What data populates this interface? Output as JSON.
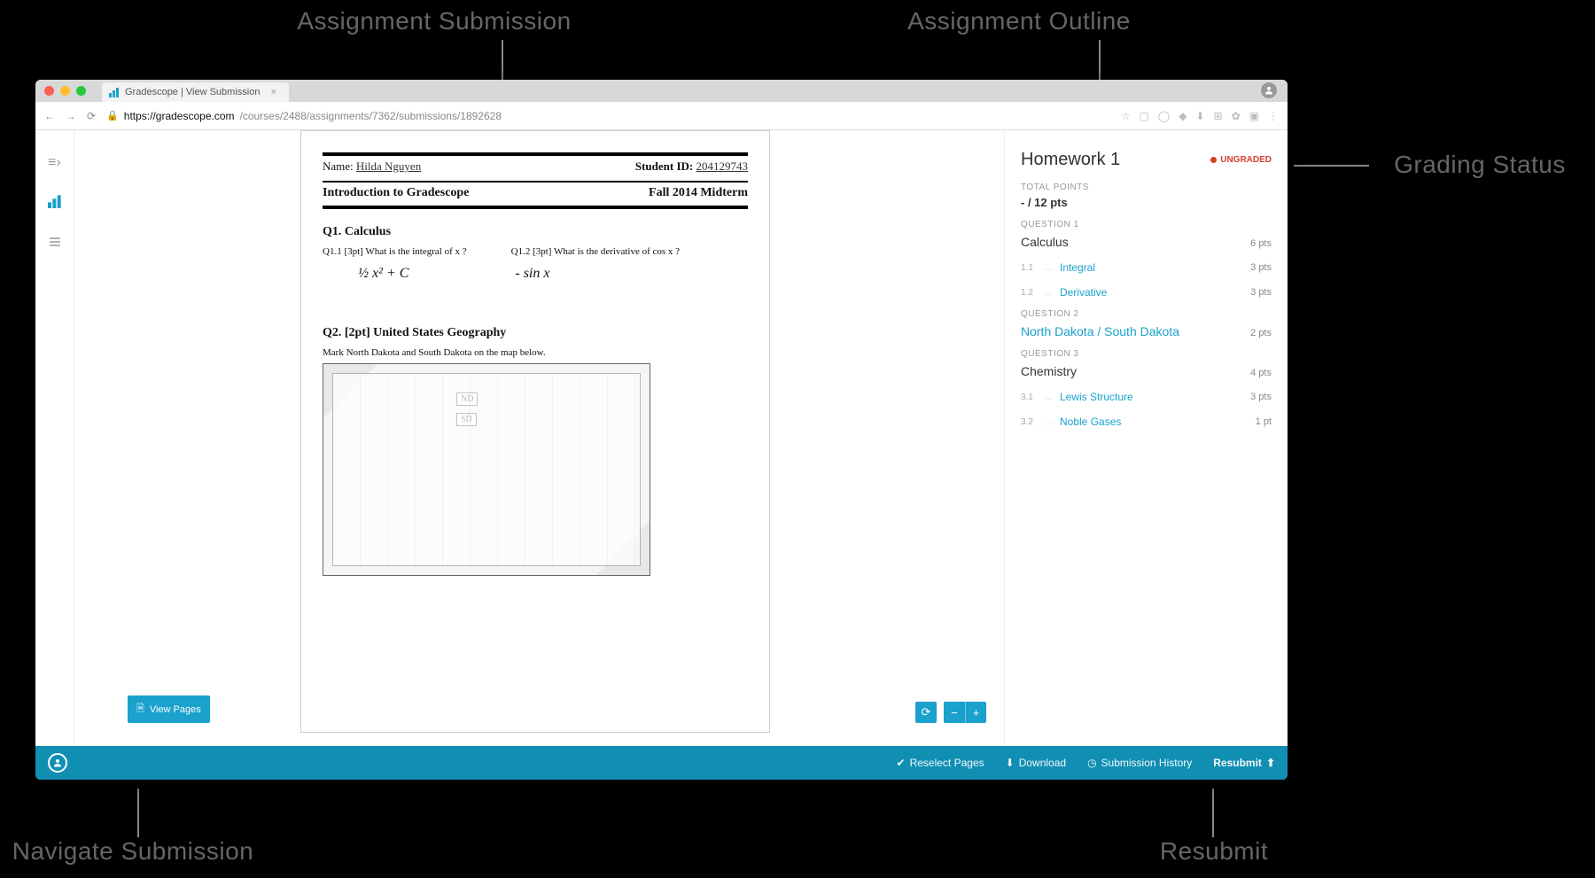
{
  "annotations": {
    "top_left": "Assignment Submission",
    "top_right": "Assignment Outline",
    "right": "Grading Status",
    "bottom_left": "Navigate Submission",
    "bottom_right": "Resubmit"
  },
  "browser": {
    "tab_title": "Gradescope | View Submission",
    "url_host": "https://gradescope.com",
    "url_path": "/courses/2488/assignments/7362/submissions/1892628"
  },
  "scan": {
    "name_label": "Name:",
    "name_value": "Hilda Nguyen",
    "sid_label": "Student ID:",
    "sid_value": "204129743",
    "course_title": "Introduction to Gradescope",
    "exam_title": "Fall 2014 Midterm",
    "q1_title": "Q1.  Calculus",
    "q11": "Q1.1  [3pt]  What is the integral of x ?",
    "q12": "Q1.2  [3pt]  What is the derivative of  cos x ?",
    "ans11": "½ x² + C",
    "ans12": "- sin x",
    "q2_title": "Q2.  [2pt] United States Geography",
    "q2_instr": "Mark North Dakota and South Dakota on the map below.",
    "map_nd": "ND",
    "map_sd": "SD"
  },
  "controls": {
    "view_pages": "View Pages"
  },
  "outline": {
    "title": "Homework 1",
    "status": "UNGRADED",
    "total_label": "TOTAL POINTS",
    "total_value": "- / 12 pts",
    "q1": {
      "label": "QUESTION 1",
      "name": "Calculus",
      "pts": "6 pts",
      "subs": [
        {
          "num": "1.1",
          "name": "Integral",
          "pts": "3 pts"
        },
        {
          "num": "1.2",
          "name": "Derivative",
          "pts": "3 pts"
        }
      ]
    },
    "q2": {
      "label": "QUESTION 2",
      "name": "North Dakota / South Dakota",
      "pts": "2 pts"
    },
    "q3": {
      "label": "QUESTION 3",
      "name": "Chemistry",
      "pts": "4 pts",
      "subs": [
        {
          "num": "3.1",
          "name": "Lewis Structure",
          "pts": "3 pts"
        },
        {
          "num": "3.2",
          "name": "Noble Gases",
          "pts": "1 pt"
        }
      ]
    }
  },
  "footer": {
    "reselect": "Reselect Pages",
    "download": "Download",
    "history": "Submission History",
    "resubmit": "Resubmit"
  }
}
